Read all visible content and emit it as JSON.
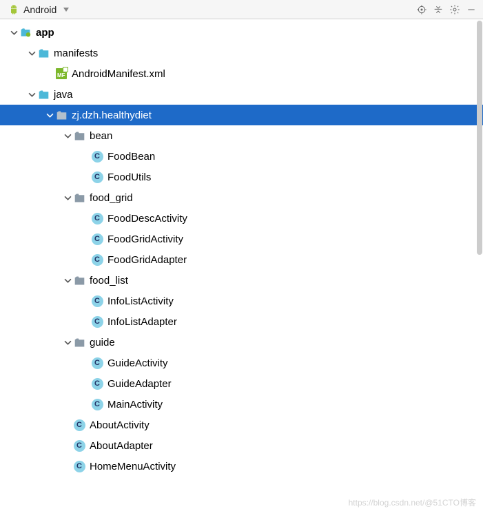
{
  "toolbar": {
    "view_label": "Android"
  },
  "tree": {
    "app": "app",
    "manifests": "manifests",
    "manifest_file": "AndroidManifest.xml",
    "java": "java",
    "pkg": "zj.dzh.healthydiet",
    "bean": "bean",
    "bean_items": [
      "FoodBean",
      "FoodUtils"
    ],
    "food_grid": "food_grid",
    "food_grid_items": [
      "FoodDescActivity",
      "FoodGridActivity",
      "FoodGridAdapter"
    ],
    "food_list": "food_list",
    "food_list_items": [
      "InfoListActivity",
      "InfoListAdapter"
    ],
    "guide": "guide",
    "guide_items": [
      "GuideActivity",
      "GuideAdapter",
      "MainActivity"
    ],
    "root_items": [
      "AboutActivity",
      "AboutAdapter",
      "HomeMenuActivity"
    ]
  },
  "watermark": "https://blog.csdn.net/@51CTO博客",
  "mf_label": "MF",
  "class_label": "C"
}
